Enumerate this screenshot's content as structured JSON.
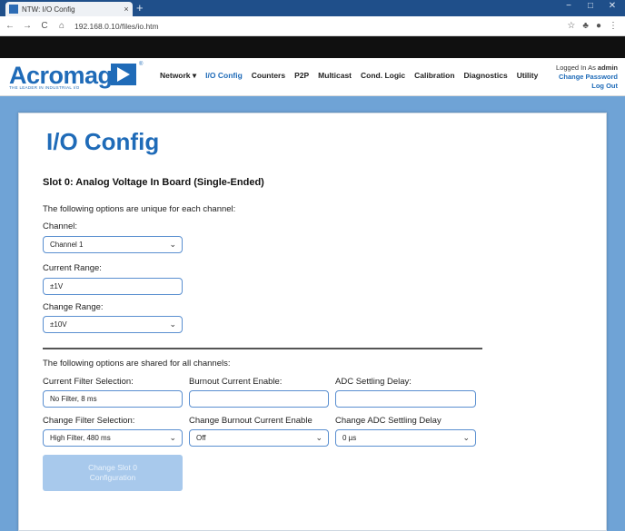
{
  "browser": {
    "tab_title": "NTW: I/O Config",
    "tab_close": "×",
    "new_tab": "+",
    "url": "192.168.0.10/files/io.htm",
    "window_controls": {
      "minimize": "−",
      "maximize": "□",
      "close": "✕"
    },
    "nav_icons": {
      "back": "←",
      "forward": "→",
      "reload": "C",
      "home": "⌂"
    },
    "toolbar_icons": {
      "bookmark": "☆",
      "extensions": "♣",
      "profile": "●",
      "menu": "⋮"
    }
  },
  "header": {
    "logo_text": "Acromag",
    "logo_tagline": "THE LEADER IN INDUSTRIAL I/O",
    "logo_registered": "®",
    "nav": [
      {
        "label": "Network ▾",
        "active": false
      },
      {
        "label": "I/O Config",
        "active": true
      },
      {
        "label": "Counters",
        "active": false
      },
      {
        "label": "P2P",
        "active": false
      },
      {
        "label": "Multicast",
        "active": false
      },
      {
        "label": "Cond. Logic",
        "active": false
      },
      {
        "label": "Calibration",
        "active": false
      },
      {
        "label": "Diagnostics",
        "active": false
      },
      {
        "label": "Utility",
        "active": false
      }
    ],
    "login": {
      "prefix": "Logged In As ",
      "user": "admin",
      "change_password": "Change Password",
      "logout": "Log Out"
    }
  },
  "main": {
    "title": "I/O Config",
    "slot_title": "Slot 0: Analog Voltage In Board (Single-Ended)",
    "unique_note": "The following options are unique for each channel:",
    "channel_label": "Channel:",
    "channel_value": "Channel 1",
    "current_range_label": "Current Range:",
    "current_range_value": "±1V",
    "change_range_label": "Change Range:",
    "change_range_value": "±10V",
    "shared_note": "The following options are shared for all channels:",
    "current_filter_label": "Current Filter Selection:",
    "current_filter_value": "No Filter, 8 ms",
    "burnout_label": "Burnout Current Enable:",
    "burnout_value": "",
    "adc_label": "ADC Settling Delay:",
    "adc_value": "",
    "change_filter_label": "Change Filter Selection:",
    "change_filter_value": "High Filter, 480 ms",
    "change_burnout_label": "Change Burnout Current Enable",
    "change_burnout_value": "Off",
    "change_adc_label": "Change ADC Settling Delay",
    "change_adc_value": "0 µs",
    "submit_label": "Change Slot 0 Configuration",
    "chevron": "⌄"
  },
  "colors": {
    "accent": "#1f6bb8",
    "page_bg": "#6fa3d6",
    "button_disabled": "#a8c9ec"
  }
}
